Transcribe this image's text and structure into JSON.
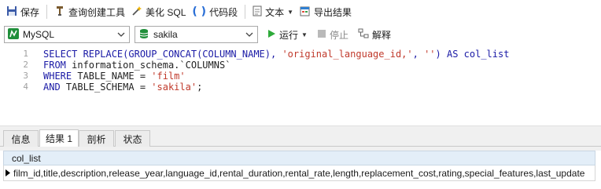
{
  "toolbar": {
    "save_label": "保存",
    "query_builder_label": "查询创建工具",
    "beautify_sql_label": "美化 SQL",
    "code_snippet_label": "代码段",
    "text_label": "文本",
    "export_result_label": "导出结果"
  },
  "connection": {
    "db_type": "MySQL",
    "database": "sakila",
    "run_label": "运行",
    "stop_label": "停止",
    "explain_label": "解释"
  },
  "editor": {
    "lines": [
      {
        "number": "1",
        "tokens": [
          {
            "t": "SELECT REPLACE",
            "c": "kw"
          },
          {
            "t": "(GROUP_CONCAT(COLUMN_NAME), ",
            "c": "kw"
          },
          {
            "t": "'original_language_id,'",
            "c": "str"
          },
          {
            "t": ", ",
            "c": "kw"
          },
          {
            "t": "''",
            "c": "str"
          },
          {
            "t": ") AS col_list",
            "c": "kw"
          }
        ]
      },
      {
        "number": "2",
        "tokens": [
          {
            "t": "FROM ",
            "c": "kw"
          },
          {
            "t": "information_schema.`COLUMNS`",
            "c": "plain"
          }
        ]
      },
      {
        "number": "3",
        "tokens": [
          {
            "t": "WHERE ",
            "c": "kw"
          },
          {
            "t": "TABLE_NAME = ",
            "c": "plain"
          },
          {
            "t": "'film'",
            "c": "str"
          }
        ]
      },
      {
        "number": "4",
        "tokens": [
          {
            "t": "AND ",
            "c": "kw"
          },
          {
            "t": "TABLE_SCHEMA = ",
            "c": "plain"
          },
          {
            "t": "'sakila'",
            "c": "str"
          },
          {
            "t": ";",
            "c": "plain"
          }
        ]
      }
    ]
  },
  "tabs": [
    {
      "label": "信息"
    },
    {
      "label": "结果 1"
    },
    {
      "label": "剖析"
    },
    {
      "label": "状态"
    }
  ],
  "result": {
    "column": "col_list",
    "value": "film_id,title,description,release_year,language_id,rental_duration,rental_rate,length,replacement_cost,rating,special_features,last_update"
  },
  "colors": {
    "keyword": "#1a1aa6",
    "string": "#c0392b",
    "run_green": "#2eaa3a",
    "db_green": "#1f8f3a"
  },
  "icons": [
    "save-icon",
    "query-builder-icon",
    "beautify-icon",
    "code-snippet-icon",
    "text-doc-icon",
    "export-icon",
    "mysql-icon",
    "database-icon",
    "run-icon",
    "stop-icon",
    "explain-icon"
  ]
}
